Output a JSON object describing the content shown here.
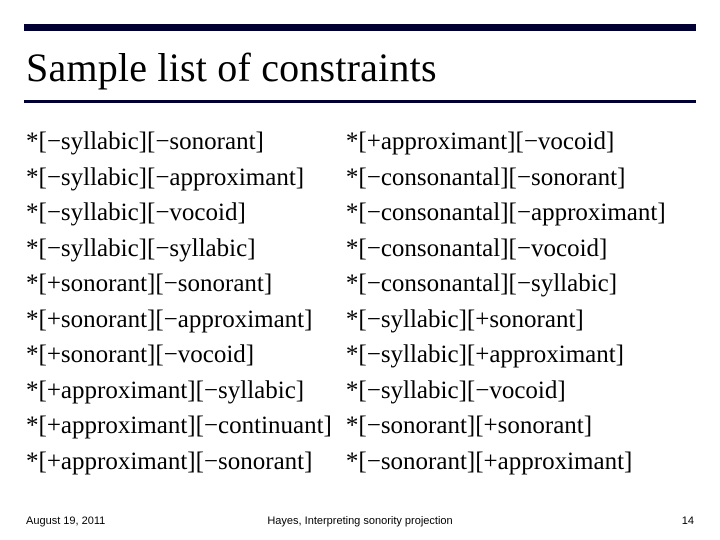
{
  "title": "Sample list of constraints",
  "left_col": [
    "*[−syllabic][−sonorant]",
    "*[−syllabic][−approximant]",
    "*[−syllabic][−vocoid]",
    "*[−syllabic][−syllabic]",
    "*[+sonorant][−sonorant]",
    "*[+sonorant][−approximant]",
    "*[+sonorant][−vocoid]",
    "*[+approximant][−syllabic]",
    "*[+approximant][−continuant]",
    "*[+approximant][−sonorant]"
  ],
  "right_col": [
    "*[+approximant][−vocoid]",
    "*[−consonantal][−sonorant]",
    "*[−consonantal][−approximant]",
    "*[−consonantal][−vocoid]",
    "*[−consonantal][−syllabic]",
    "*[−syllabic][+sonorant]",
    "*[−syllabic][+approximant]",
    "*[−syllabic][−vocoid]",
    "*[−sonorant][+sonorant]",
    "*[−sonorant][+approximant]"
  ],
  "footer": {
    "date": "August 19, 2011",
    "mid": "Hayes, Interpreting sonority projection",
    "page": "14"
  }
}
